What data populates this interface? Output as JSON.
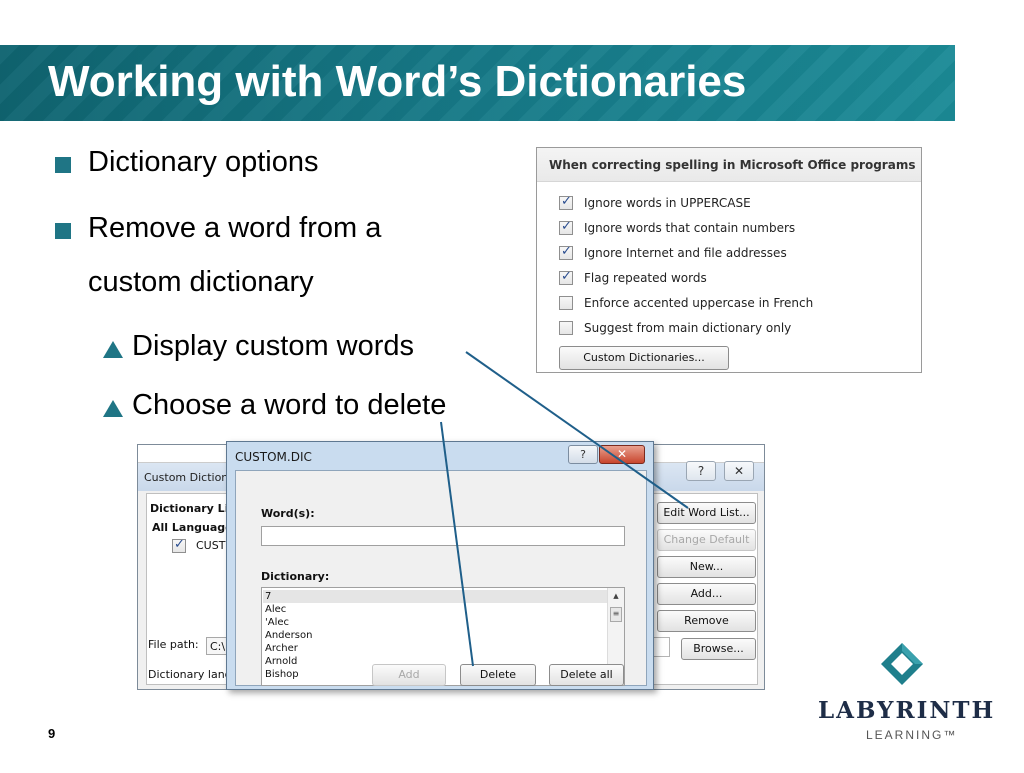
{
  "slide": {
    "title": "Working with Word’s Dictionaries",
    "page_number": "9",
    "bullets": [
      {
        "text": "Dictionary options"
      },
      {
        "text": "Remove a word from a"
      },
      {
        "text": "custom dictionary"
      }
    ],
    "sub_bullets": [
      {
        "text": "Display custom words"
      },
      {
        "text": "Choose a word to delete"
      }
    ]
  },
  "options_panel": {
    "heading": "When correcting spelling in Microsoft Office programs",
    "options": [
      {
        "label": "Ignore words in UPPERCASE",
        "checked": true
      },
      {
        "label": "Ignore words that contain numbers",
        "checked": true
      },
      {
        "label": "Ignore Internet and file addresses",
        "checked": true
      },
      {
        "label": "Flag repeated words",
        "checked": true
      },
      {
        "label": "Enforce accented uppercase in French",
        "checked": false
      },
      {
        "label": "Suggest from main dictionary only",
        "checked": false
      }
    ],
    "button_label": "Custom Dictionaries..."
  },
  "custom_dictionaries_window": {
    "title": "Custom Diction",
    "list_header": "Dictionary Lis",
    "all_languages": "All Language",
    "entry": "CUSTO",
    "file_path_label": "File path:",
    "file_path_value": "C:\\",
    "dictionary_language_label": "Dictionary langu",
    "help_button": "?",
    "close_button": "✕",
    "buttons": [
      {
        "label": "Edit Word List...",
        "disabled": false
      },
      {
        "label": "Change Default",
        "disabled": true
      },
      {
        "label": "New...",
        "disabled": false
      },
      {
        "label": "Add...",
        "disabled": false
      },
      {
        "label": "Remove",
        "disabled": false
      },
      {
        "label": "Browse...",
        "disabled": false
      }
    ]
  },
  "custom_dic_dialog": {
    "title": "CUSTOM.DIC",
    "help_button": "?",
    "close_button": "✕",
    "words_label": "Word(s):",
    "words_value": "",
    "dictionary_label": "Dictionary:",
    "words": [
      "7",
      "Alec",
      "'Alec",
      "Anderson",
      "Archer",
      "Arnold",
      "Bishop"
    ],
    "buttons": {
      "add": "Add",
      "delete": "Delete",
      "delete_all": "Delete all"
    }
  },
  "logo": {
    "name": "LABYRINTH",
    "tagline": "LEARNING™"
  },
  "colors": {
    "title_band": "#167886",
    "accent": "#1f7585",
    "callout_line": "#1f5f8a"
  }
}
